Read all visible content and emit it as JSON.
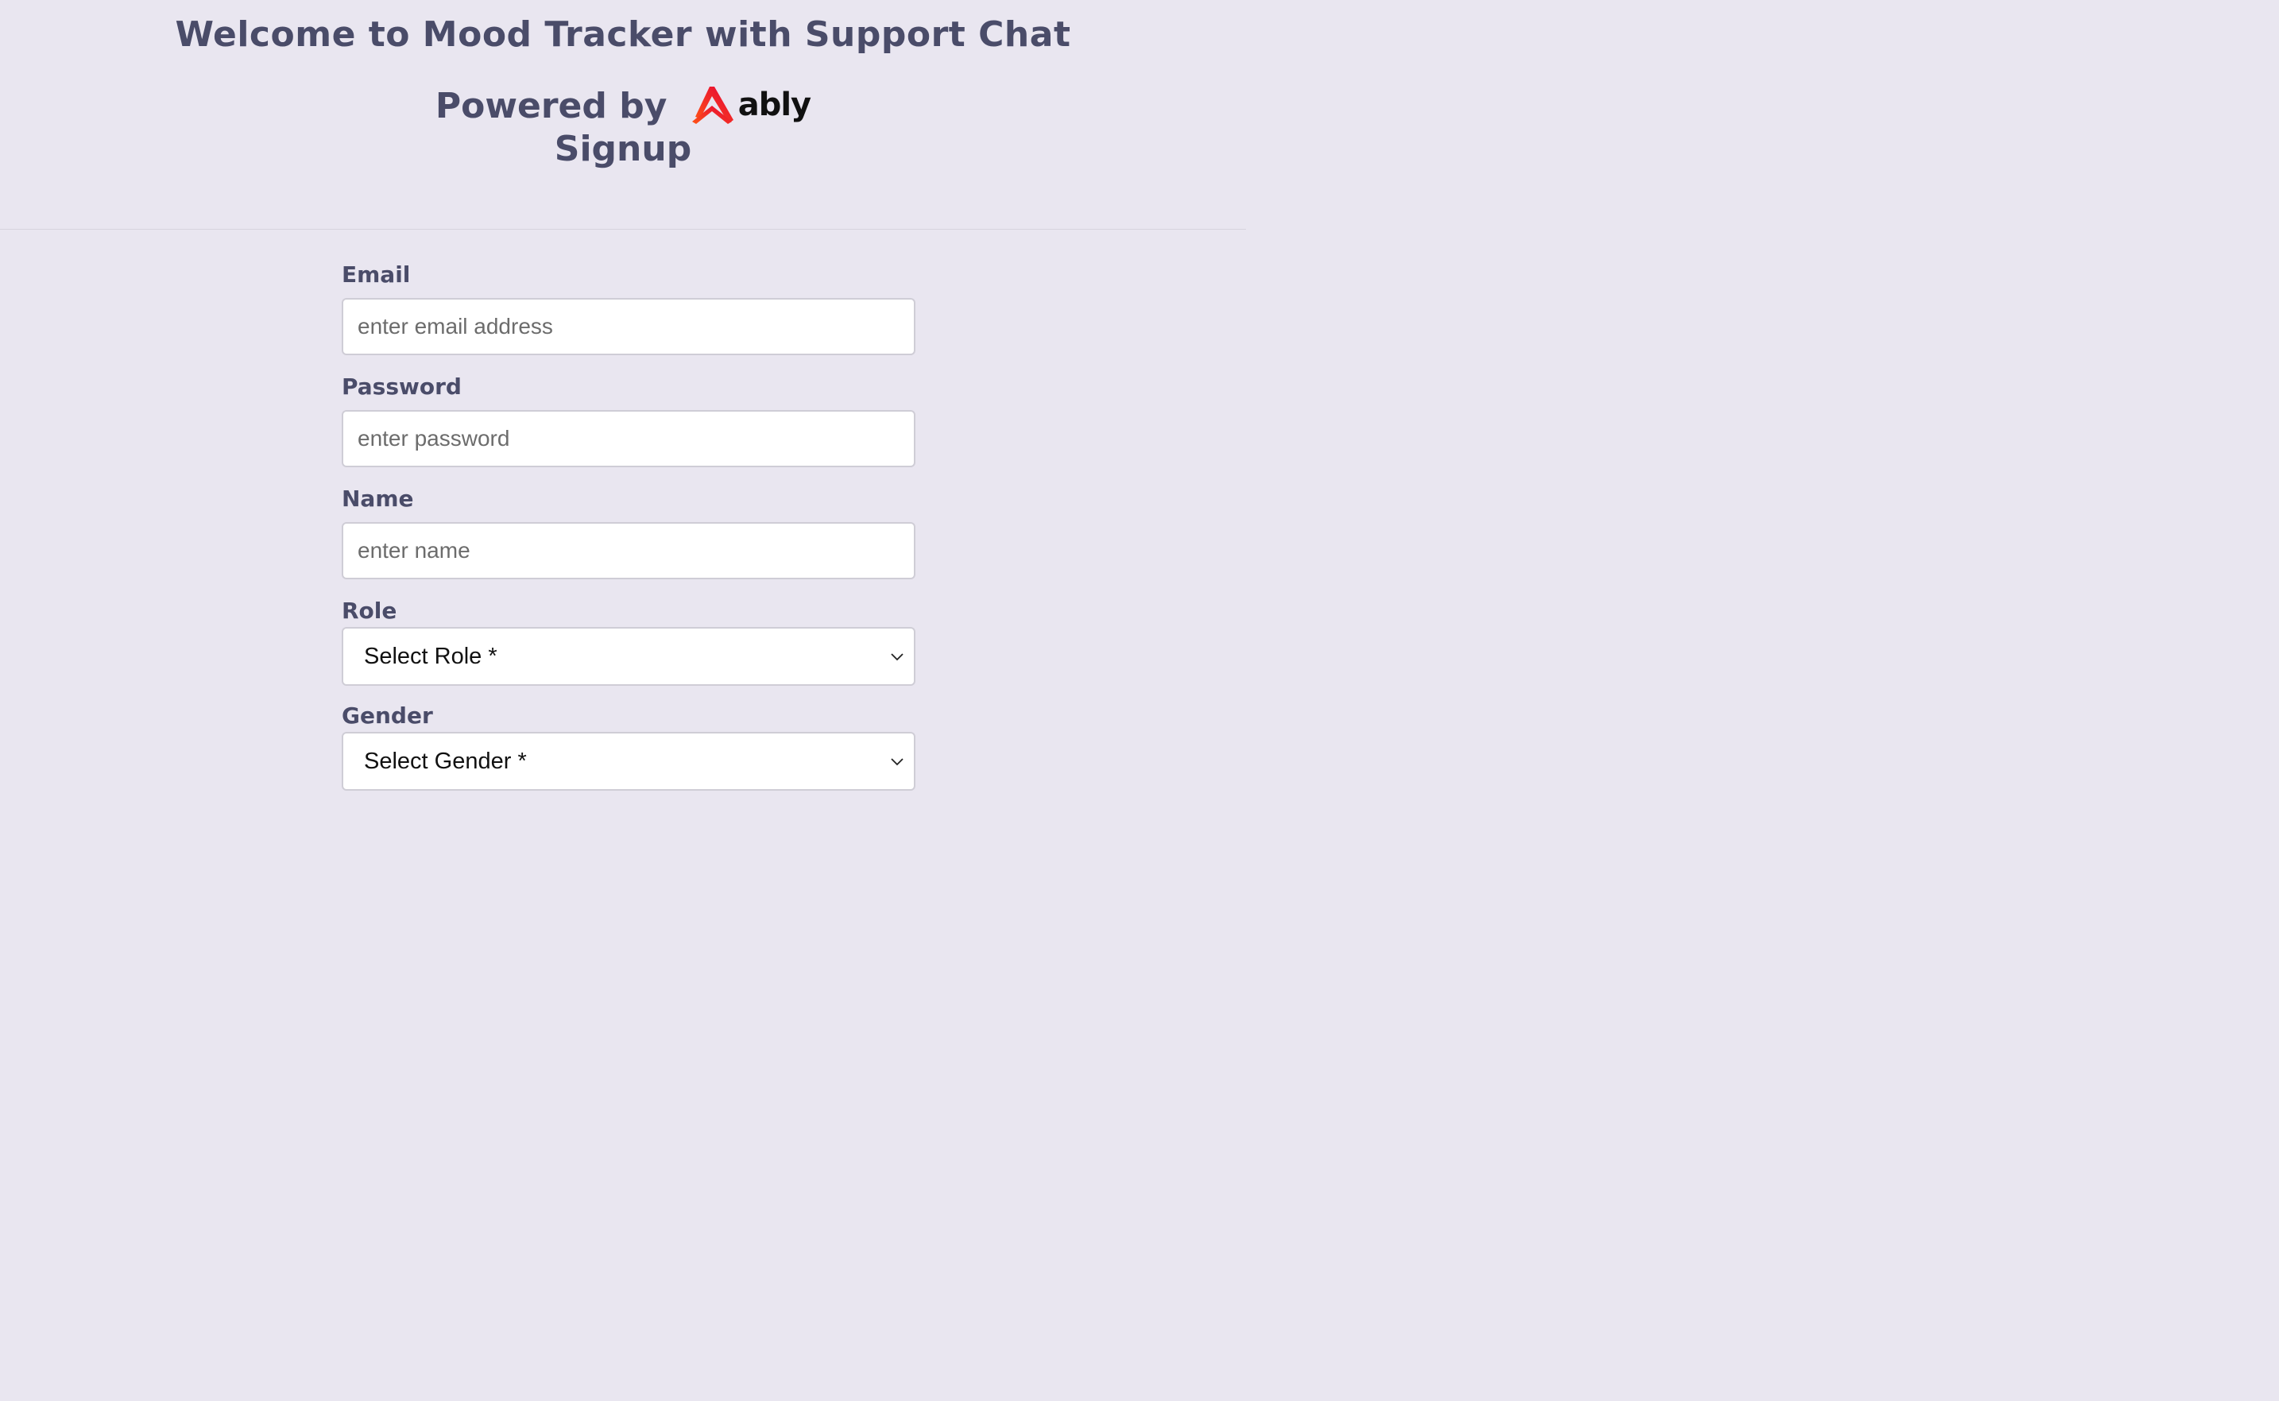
{
  "header": {
    "title": "Welcome to Mood Tracker with Support Chat",
    "powered_by": "Powered by",
    "brand": "ably",
    "subtitle": "Signup",
    "colors": {
      "heading": "#4a4c69",
      "brand_gradient_start": "#ff5416",
      "brand_gradient_end": "#e40138"
    }
  },
  "form": {
    "email": {
      "label": "Email",
      "placeholder": "enter email address"
    },
    "password": {
      "label": "Password",
      "placeholder": "enter password"
    },
    "name": {
      "label": "Name",
      "placeholder": "enter name"
    },
    "role": {
      "label": "Role",
      "selected": "Select Role *",
      "icon": "chevron-down-icon"
    },
    "gender": {
      "label": "Gender",
      "selected": "Select Gender *",
      "icon": "chevron-down-icon"
    }
  }
}
